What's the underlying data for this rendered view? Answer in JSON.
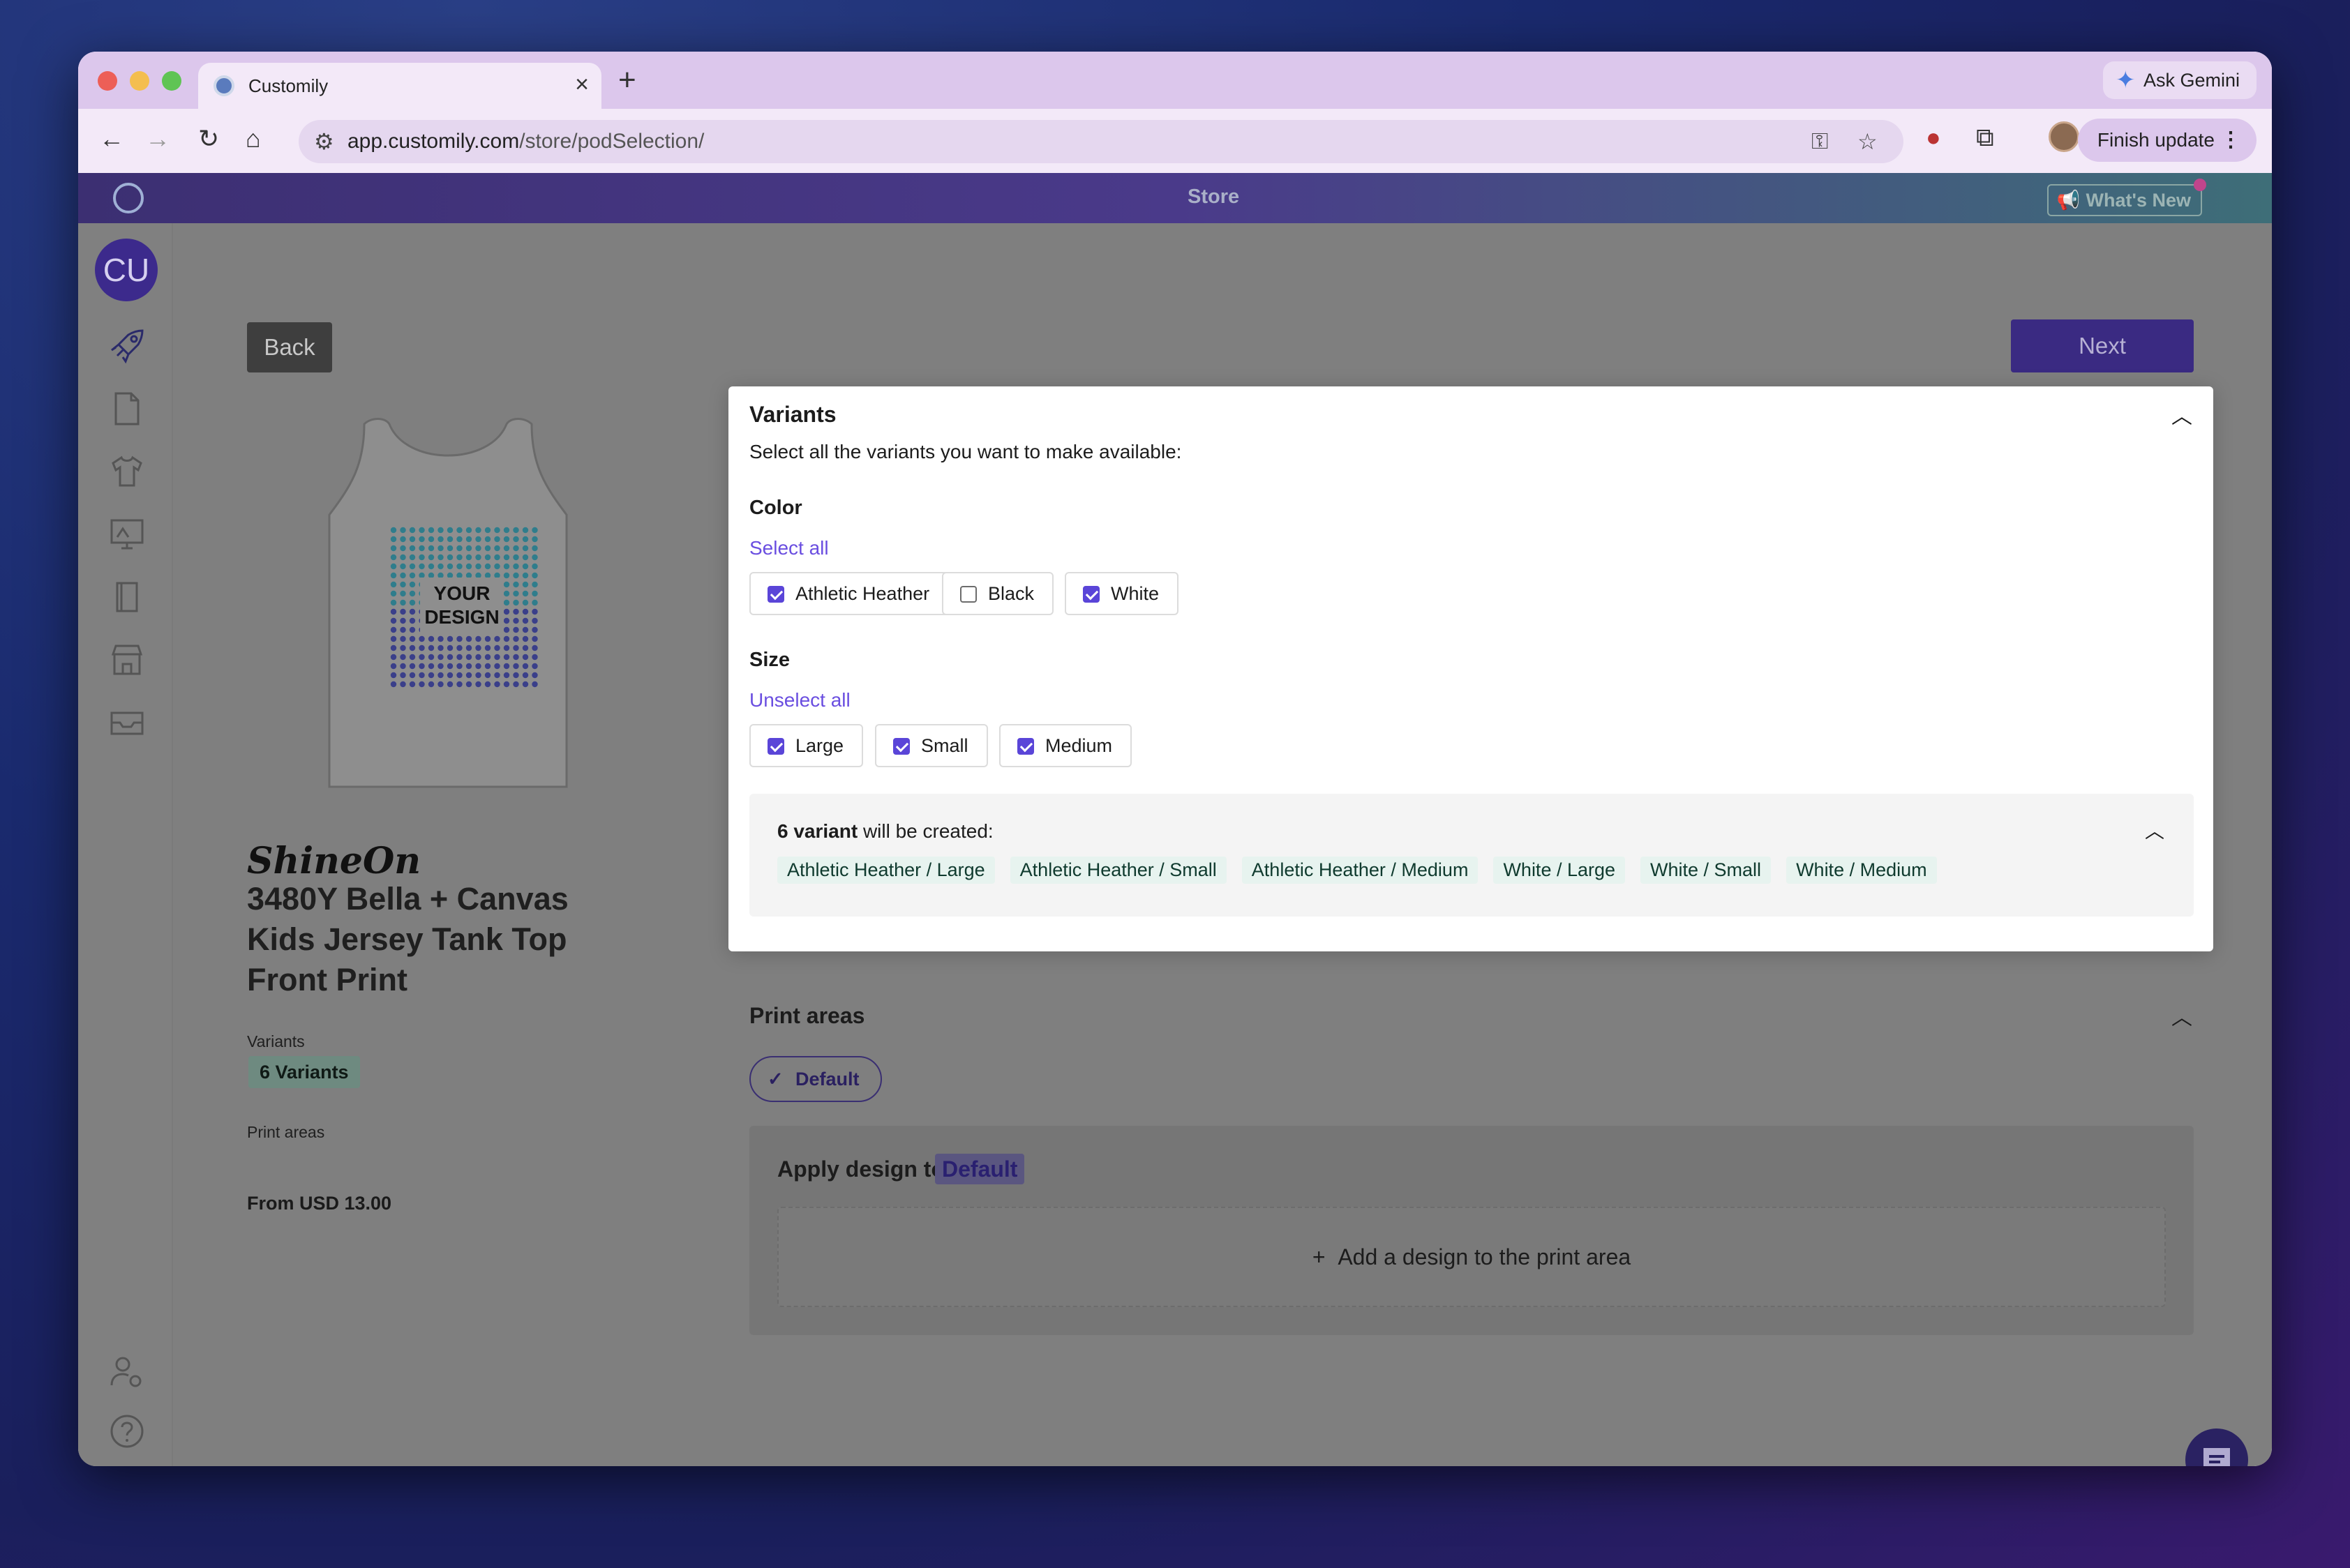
{
  "browser": {
    "tab_title": "Customily",
    "url_host": "app.customily.com",
    "url_path": "/store/podSelection/",
    "ask_gemini": "Ask Gemini",
    "finish_update": "Finish update"
  },
  "app": {
    "header_title": "Store",
    "whats_new": "What's New",
    "user_initials": "CU"
  },
  "actions": {
    "back": "Back",
    "next": "Next"
  },
  "product": {
    "brand": "ShineOn",
    "title": "3480Y Bella + Canvas Kids Jersey Tank Top Front Print",
    "variants_label": "Variants",
    "variants_count": "6 Variants",
    "print_areas_label": "Print areas",
    "price": "From USD 13.00",
    "mockup_text_line1": "YOUR",
    "mockup_text_line2": "DESIGN"
  },
  "variants_modal": {
    "title": "Variants",
    "subtitle": "Select all the variants you want to make available:",
    "color": {
      "label": "Color",
      "toggle_link": "Select all",
      "options": [
        {
          "label": "Athletic Heather",
          "checked": true
        },
        {
          "label": "Black",
          "checked": false
        },
        {
          "label": "White",
          "checked": true
        }
      ]
    },
    "size": {
      "label": "Size",
      "toggle_link": "Unselect all",
      "options": [
        {
          "label": "Large",
          "checked": true
        },
        {
          "label": "Small",
          "checked": true
        },
        {
          "label": "Medium",
          "checked": true
        }
      ]
    },
    "summary": {
      "count": "6 variant",
      "suffix": " will be created:",
      "items": [
        "Athletic Heather / Large",
        "Athletic Heather / Small",
        "Athletic Heather / Medium",
        "White / Large",
        "White / Small",
        "White / Medium"
      ]
    }
  },
  "print_areas": {
    "title": "Print areas",
    "chip": "Default",
    "apply_label": "Apply design to",
    "apply_target": "Default",
    "add_design": "Add a design to the print area"
  }
}
